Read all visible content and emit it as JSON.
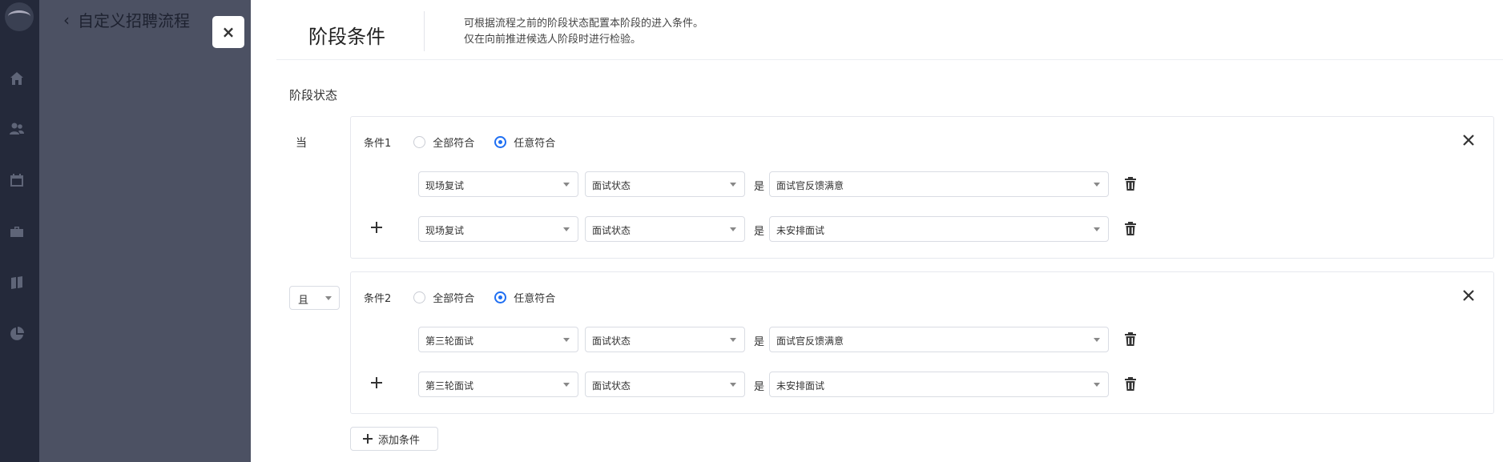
{
  "rail": {
    "icons": [
      "home-icon",
      "users-icon",
      "calendar-icon",
      "briefcase-icon",
      "book-icon",
      "pie-chart-icon"
    ]
  },
  "backpage": {
    "title": "自定义招聘流程"
  },
  "close_button": {
    "label": "×"
  },
  "drawer": {
    "title": "阶段条件",
    "desc_line1": "可根据流程之前的阶段状态配置本阶段的进入条件。",
    "desc_line2": "仅在向前推进候选人阶段时进行检验。",
    "section_label": "阶段状态",
    "when_label": "当",
    "and_select_value": "且",
    "add_condition_label": "添加条件",
    "conditions": [
      {
        "name": "条件1",
        "option_all": "全部符合",
        "option_any": "任意符合",
        "selected": "任意符合",
        "rows": [
          {
            "stage": "现场复试",
            "field": "面试状态",
            "op": "是",
            "value": "面试官反馈满意"
          },
          {
            "stage": "现场复试",
            "field": "面试状态",
            "op": "是",
            "value": "未安排面试"
          }
        ]
      },
      {
        "name": "条件2",
        "option_all": "全部符合",
        "option_any": "任意符合",
        "selected": "任意符合",
        "rows": [
          {
            "stage": "第三轮面试",
            "field": "面试状态",
            "op": "是",
            "value": "面试官反馈满意"
          },
          {
            "stage": "第三轮面试",
            "field": "面试状态",
            "op": "是",
            "value": "未安排面试"
          }
        ]
      }
    ]
  },
  "colors": {
    "accent": "#1f6ff2",
    "rail_bg": "#24293a",
    "overlay_bg": "#4c5163"
  }
}
